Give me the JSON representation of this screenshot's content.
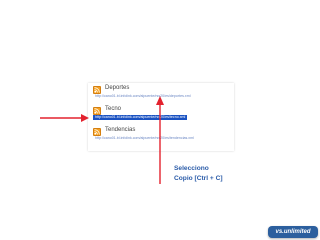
{
  "feeds": [
    {
      "name": "Deportes",
      "url": "http://cano01.bl.infolink.com/alpuente/rss20/es/deportes.xml",
      "selected": false
    },
    {
      "name": "Tecno",
      "url": "http://cano01.bl.infolink.com/alpuente/rss20/es/tecno.xml",
      "selected": true
    },
    {
      "name": "Tendencias",
      "url": "http://cano01.bl.infolink.com/alpuente/rss20/es/tendencias.xml",
      "selected": false
    }
  ],
  "instructions": {
    "line1": "Selecciono",
    "line2": "Copio [Ctrl + C]"
  },
  "badge": {
    "label": "vs.unlimited"
  },
  "colors": {
    "selection": "#1a52c2",
    "arrow": "#e3222e",
    "instruction_text": "#2a5ba8",
    "rss": "#f5a123"
  }
}
